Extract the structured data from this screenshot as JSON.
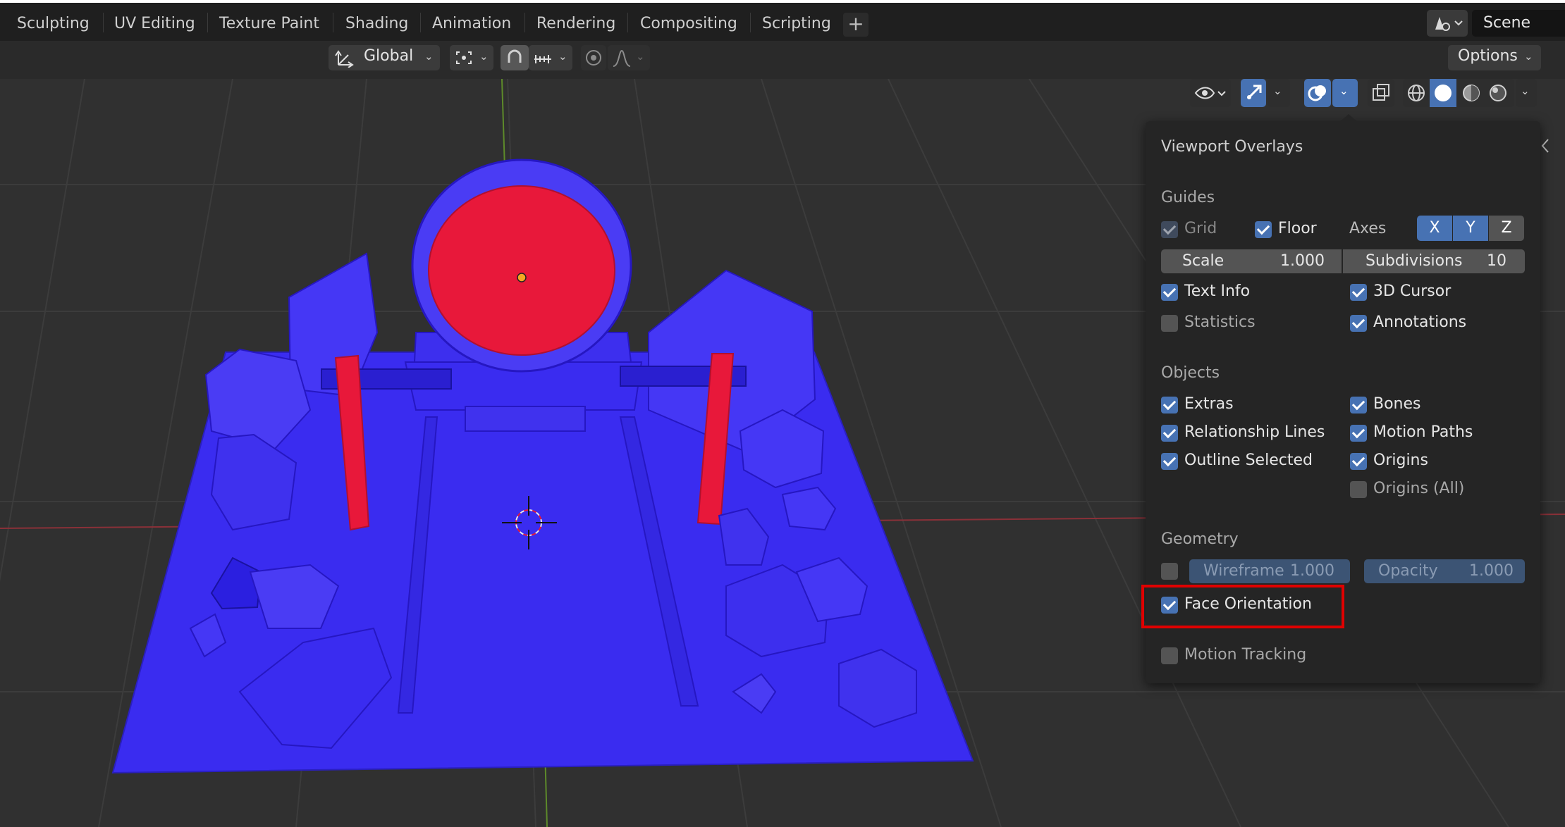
{
  "workspace_tabs": [
    "Sculpting",
    "UV Editing",
    "Texture Paint",
    "Shading",
    "Animation",
    "Rendering",
    "Compositing",
    "Scripting"
  ],
  "add_workspace": "+",
  "scene": {
    "name": "Scene"
  },
  "header": {
    "orientation": "Global",
    "options": "Options"
  },
  "overlays": {
    "title": "Viewport Overlays",
    "guides": {
      "label": "Guides",
      "grid": {
        "label": "Grid",
        "checked": true
      },
      "floor": {
        "label": "Floor",
        "checked": true
      },
      "axes_label": "Axes",
      "axes": [
        "X",
        "Y",
        "Z"
      ],
      "scale": {
        "label": "Scale",
        "value": "1.000"
      },
      "subdivisions": {
        "label": "Subdivisions",
        "value": "10"
      },
      "text_info": {
        "label": "Text Info",
        "checked": true
      },
      "cursor_3d": {
        "label": "3D Cursor",
        "checked": true
      },
      "statistics": {
        "label": "Statistics",
        "checked": false
      },
      "annotations": {
        "label": "Annotations",
        "checked": true
      }
    },
    "objects": {
      "label": "Objects",
      "extras": {
        "label": "Extras",
        "checked": true
      },
      "bones": {
        "label": "Bones",
        "checked": true
      },
      "relationship_lines": {
        "label": "Relationship Lines",
        "checked": true
      },
      "motion_paths": {
        "label": "Motion Paths",
        "checked": true
      },
      "outline_selected": {
        "label": "Outline Selected",
        "checked": true
      },
      "origins": {
        "label": "Origins",
        "checked": true
      },
      "origins_all": {
        "label": "Origins (All)",
        "checked": false
      }
    },
    "geometry": {
      "label": "Geometry",
      "wireframe": {
        "label": "Wireframe",
        "value": "1.000",
        "checked": false
      },
      "opacity": {
        "label": "Opacity",
        "value": "1.000"
      },
      "face_orientation": {
        "label": "Face Orientation",
        "checked": true
      }
    },
    "motion_tracking": {
      "label": "Motion Tracking",
      "checked": false
    }
  },
  "colors": {
    "accent": "#4772b3",
    "face_front": "#3a2cf0",
    "face_back": "#e8183a",
    "highlight": "#e00000"
  }
}
